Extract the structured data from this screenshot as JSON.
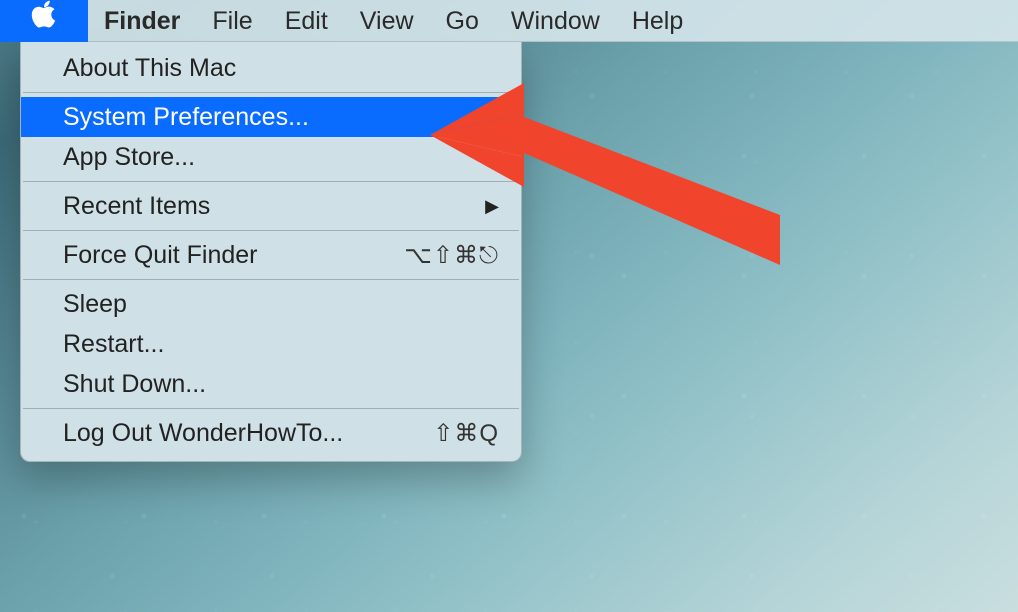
{
  "menubar": {
    "app_name": "Finder",
    "items": [
      "File",
      "Edit",
      "View",
      "Go",
      "Window",
      "Help"
    ]
  },
  "apple_menu": {
    "about": "About This Mac",
    "system_preferences": "System Preferences...",
    "app_store": "App Store...",
    "recent_items": "Recent Items",
    "force_quit": "Force Quit Finder",
    "force_quit_shortcut": "⌥⇧⌘⎋",
    "sleep": "Sleep",
    "restart": "Restart...",
    "shut_down": "Shut Down...",
    "log_out": "Log Out WonderHowTo...",
    "log_out_shortcut": "⇧⌘Q"
  },
  "highlighted_item": "system_preferences"
}
